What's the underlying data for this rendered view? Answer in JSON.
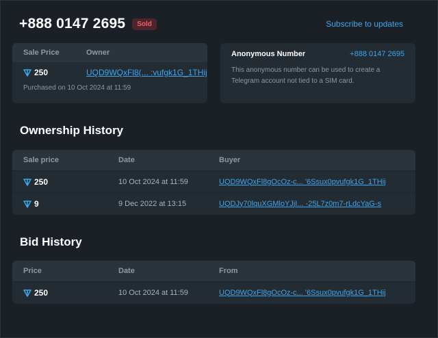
{
  "header": {
    "phone": "+888 0147 2695",
    "status_badge": "Sold",
    "subscribe_label": "Subscribe to updates"
  },
  "sale_card": {
    "col_price": "Sale Price",
    "col_owner": "Owner",
    "price": "250",
    "owner": "UQD9WQxFl8(... :vufgk1G_1THij",
    "purchased": "Purchased on 10 Oct 2024 at 11:59"
  },
  "anon_card": {
    "title": "Anonymous Number",
    "number": "+888 0147 2695",
    "description_line1": "This anonymous number can be used to create a",
    "description_line2": "Telegram account not tied to a SIM card."
  },
  "ownership": {
    "title": "Ownership History",
    "columns": [
      "Sale price",
      "Date",
      "Buyer"
    ],
    "rows": [
      {
        "price": "250",
        "date": "10 Oct 2024 at 11:59",
        "buyer": "UQD9WQxFl8gOcOz-c... '6Ssux0pvufgk1G_1THij"
      },
      {
        "price": "9",
        "date": "9 Dec 2022 at 13:15",
        "buyer": "UQDJy70lquXGMloYJjI... -25L7z0m7-rLdcYaG-s"
      }
    ]
  },
  "bids": {
    "title": "Bid History",
    "columns": [
      "Price",
      "Date",
      "From"
    ],
    "rows": [
      {
        "price": "250",
        "date": "10 Oct 2024 at 11:59",
        "from": "UQD9WQxFl8gOcOz-c... '6Ssux0pvufgk1G_1THij"
      }
    ]
  },
  "colors": {
    "accent": "#3ea6f0",
    "sold": "#f0626a",
    "background": "#1a2026",
    "card": "#232b33"
  },
  "icons": {
    "currency": "ton-icon"
  }
}
